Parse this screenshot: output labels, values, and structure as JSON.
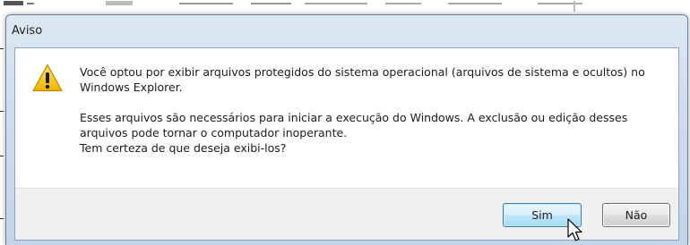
{
  "dialog": {
    "title": "Aviso",
    "icon": "warning-icon",
    "message": {
      "paragraph1": "Você optou por exibir arquivos protegidos do sistema operacional (arquivos de sistema e ocultos) no Windows Explorer.",
      "paragraph2_line1": "Esses arquivos são necessários para iniciar a execução do Windows. A exclusão ou edição desses arquivos pode tornar o computador inoperante.",
      "paragraph2_line2": "Tem certeza de que deseja exibi-los?"
    },
    "buttons": {
      "yes_label": "Sim",
      "no_label": "Não"
    }
  },
  "colors": {
    "frame": "#cfdced",
    "warning_yellow": "#f5c800",
    "focused_button_border": "#3c7fb1"
  }
}
